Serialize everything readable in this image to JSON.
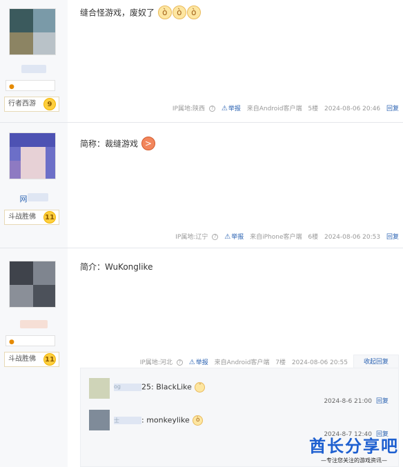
{
  "posts": [
    {
      "level_label": "行者西游",
      "level_num": "9",
      "content": "缝合怪游戏，废奴了",
      "ip": "IP属地:陕西",
      "report": "举报",
      "source": "来自Android客户端",
      "floor": "5楼",
      "time": "2024-08-06 20:46",
      "reply": "回复"
    },
    {
      "username": "网",
      "level_label": "斗战胜佛",
      "level_num": "11",
      "content": "简称：裁缝游戏",
      "ip": "IP属地:辽宁",
      "report": "举报",
      "source": "来自iPhone客户端",
      "floor": "6楼",
      "time": "2024-08-06 20:53",
      "reply": "回复"
    },
    {
      "level_label": "斗战胜佛",
      "level_num": "11",
      "content": "简介：WuKonglike",
      "ip": "IP属地:河北",
      "report": "举报",
      "source": "来自Android客户端",
      "floor": "7楼",
      "time": "2024-08-06 20:55",
      "collapse": "收起回复"
    }
  ],
  "sub_replies": [
    {
      "name": "og",
      "text": "25: BlackLike",
      "time": "2024-8-6 21:00",
      "reply": "回复"
    },
    {
      "name": "士",
      "text": ": monkeylike",
      "time": "2024-8-7 12:40",
      "reply": "回复"
    }
  ],
  "watermark": {
    "title": "酋长分享吧",
    "subtitle": "—专注您关注的游戏资讯—"
  },
  "colors": {
    "link": "#2d64b3",
    "sidebar": "#f7f8fa",
    "level_badge": "#ffcf3d",
    "watermark": "#1d5fd0"
  }
}
